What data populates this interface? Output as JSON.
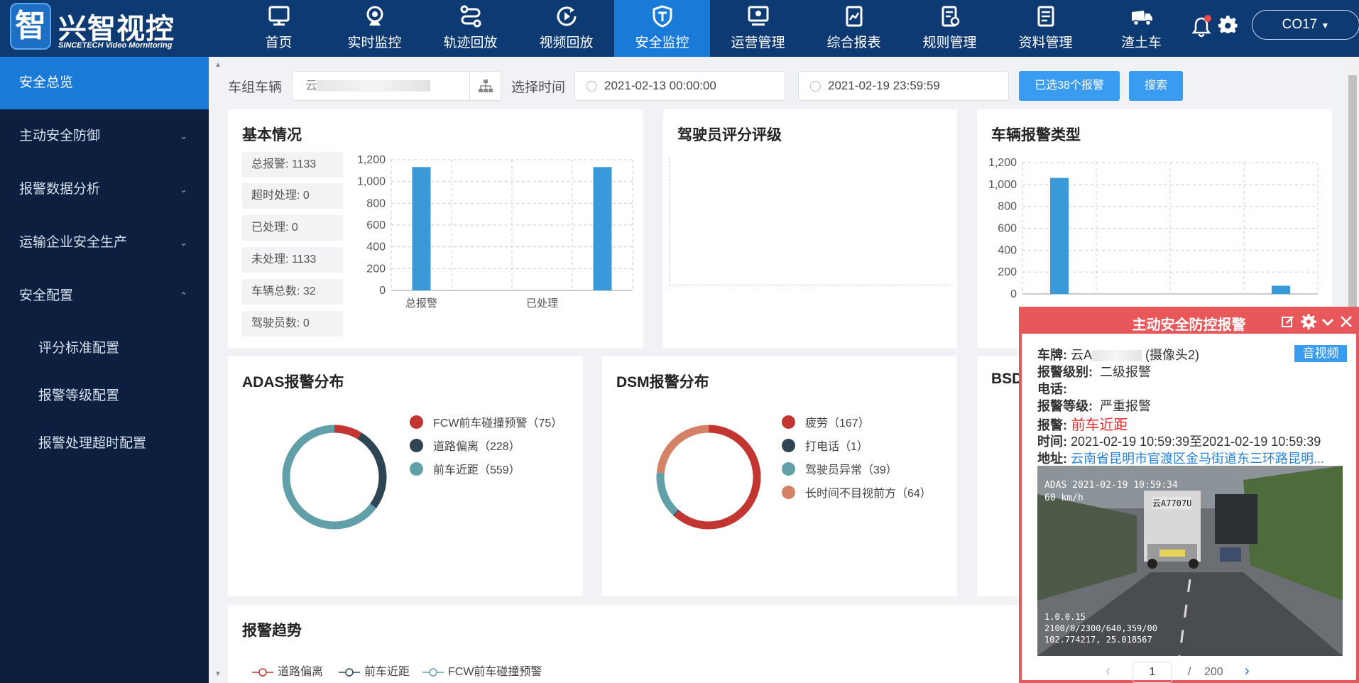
{
  "app": {
    "logo_char": "智",
    "logo_title": "兴智视控",
    "logo_sub": "SINCETECH Video Mornitoring",
    "user": "CO17"
  },
  "nav": [
    {
      "label": "首页",
      "icon": "monitor-icon"
    },
    {
      "label": "实时监控",
      "icon": "webcam-icon"
    },
    {
      "label": "轨迹回放",
      "icon": "route-icon"
    },
    {
      "label": "视频回放",
      "icon": "replay-icon"
    },
    {
      "label": "安全监控",
      "icon": "shield-icon",
      "active": true
    },
    {
      "label": "运营管理",
      "icon": "screen-icon"
    },
    {
      "label": "综合报表",
      "icon": "report-icon"
    },
    {
      "label": "规则管理",
      "icon": "rules-icon"
    },
    {
      "label": "资料管理",
      "icon": "document-icon"
    },
    {
      "label": "渣土车",
      "icon": "truck-icon"
    }
  ],
  "sidebar": {
    "items": [
      {
        "label": "安全总览",
        "active": true
      },
      {
        "label": "主动安全防御"
      },
      {
        "label": "报警数据分析"
      },
      {
        "label": "运输企业安全生产"
      },
      {
        "label": "安全配置",
        "expanded": true
      }
    ],
    "sub_items": [
      {
        "label": "评分标准配置"
      },
      {
        "label": "报警等级配置"
      },
      {
        "label": "报警处理超时配置"
      }
    ]
  },
  "filter": {
    "vehicle_label": "车组车辆",
    "vehicle_value": "云",
    "time_label": "选择时间",
    "start_time": "2021-02-13 00:00:00",
    "end_time": "2021-02-19 23:59:59",
    "selected_btn": "已选38个报警",
    "search_btn": "搜索"
  },
  "basic": {
    "title": "基本情况",
    "stats": [
      "总报警: 1133",
      "超时处理: 0",
      "已处理: 0",
      "未处理: 1133",
      "车辆总数: 32",
      "驾驶员数: 0"
    ]
  },
  "driver_card": {
    "title": "驾驶员评分评级"
  },
  "alarm_type_card": {
    "title": "车辆报警类型"
  },
  "adas_card": {
    "title": "ADAS报警分布"
  },
  "dsm_card": {
    "title": "DSM报警分布"
  },
  "bsd_card": {
    "title": "BSD"
  },
  "trend_card": {
    "title": "报警趋势"
  },
  "chart_data": [
    {
      "type": "bar",
      "categories": [
        "总报警",
        "",
        "已处理",
        ""
      ],
      "values": [
        1133,
        0,
        0,
        1133
      ],
      "ylim": [
        0,
        1200
      ],
      "yticks": [
        "0",
        "200",
        "400",
        "600",
        "800",
        "1,000",
        "1,200"
      ],
      "color": "#3a9ad9",
      "grid": true
    },
    {
      "type": "bar",
      "categories": [
        "",
        "",
        "",
        ""
      ],
      "values": [
        1060,
        0,
        0,
        75
      ],
      "ylim": [
        0,
        1200
      ],
      "yticks": [
        "0",
        "200",
        "400",
        "600",
        "800",
        "1,000",
        "1,200"
      ],
      "color": "#3a9ad9",
      "grid": true
    },
    {
      "type": "pie",
      "donut": true,
      "series": [
        {
          "name": "FCW前车碰撞预警（75）",
          "value": 75,
          "color": "#c23531"
        },
        {
          "name": "道路偏离（228）",
          "value": 228,
          "color": "#2f4554"
        },
        {
          "name": "前车近距（559）",
          "value": 559,
          "color": "#61a0a8"
        }
      ]
    },
    {
      "type": "pie",
      "donut": true,
      "series": [
        {
          "name": "疲劳（167）",
          "value": 167,
          "color": "#c23531"
        },
        {
          "name": "打电话（1）",
          "value": 1,
          "color": "#2f4554"
        },
        {
          "name": "驾驶员异常（39）",
          "value": 39,
          "color": "#61a0a8"
        },
        {
          "name": "长时间不目视前方（64）",
          "value": 64,
          "color": "#d48265"
        }
      ]
    },
    {
      "type": "line",
      "series": [
        {
          "name": "道路偏离",
          "color": "#c23531"
        },
        {
          "name": "前车近距",
          "color": "#2f4554"
        },
        {
          "name": "FCW前车碰撞预警",
          "color": "#61a0a8"
        }
      ]
    }
  ],
  "popup": {
    "title": "主动安全防控报警",
    "av_button": "音视频",
    "plate_label": "车牌:",
    "plate_value": "云A",
    "plate_suffix": "(摄像头2)",
    "level_label": "报警级别:",
    "level_value": "二级报警",
    "phone_label": "电话:",
    "grade_label": "报警等级:",
    "grade_value": "严重报警",
    "alarm_label": "报警:",
    "alarm_value": "前车近距",
    "time_label": "时间:",
    "time_value": "2021-02-19 10:59:39至2021-02-19 10:59:39",
    "addr_label": "地址:",
    "addr_value": "云南省昆明市官渡区金马街道东三环路昆明...",
    "photo_line1": "ADAS 2021-02-19 10:59:34",
    "photo_line2": "60 km/h",
    "photo_plate": "云A7707U",
    "photo_foot1": "1.0.0.15",
    "photo_foot2": "2100/0/2300/640,359/00",
    "photo_foot3": "102.774217, 25.018567",
    "page_current": "1",
    "page_sep": "/",
    "page_total": "200"
  }
}
